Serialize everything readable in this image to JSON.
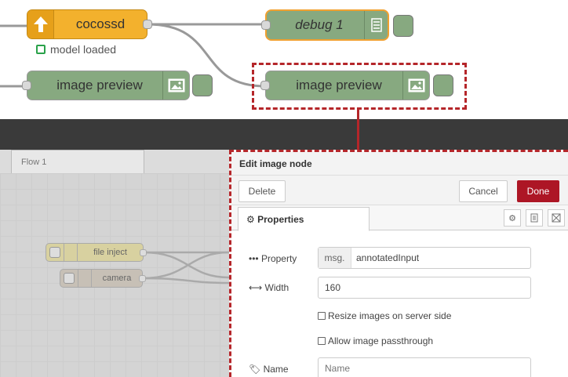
{
  "nodes": {
    "cocossd": {
      "label": "cocossd",
      "status": "model loaded"
    },
    "debug": {
      "label": "debug 1"
    },
    "preview_left": {
      "label": "image preview"
    },
    "preview_right": {
      "label": "image preview"
    }
  },
  "workspace": {
    "tab": "Flow 1",
    "nodes": [
      {
        "label": "file inject"
      },
      {
        "label": "camera"
      }
    ]
  },
  "tray": {
    "title": "Edit image node",
    "delete": "Delete",
    "cancel": "Cancel",
    "done": "Done",
    "tab": "Properties",
    "property": {
      "label": "Property",
      "prefix": "msg.",
      "value": "annotatedInput"
    },
    "width": {
      "label": "Width",
      "value": "160"
    },
    "resize": "Resize images on server side",
    "passthrough": "Allow image passthrough",
    "name": {
      "label": "Name",
      "placeholder": "Name"
    }
  },
  "colors": {
    "accent_red": "#b5262a",
    "done_button": "#ad1625",
    "node_green": "#87a980",
    "node_orange": "#f3b12d"
  }
}
